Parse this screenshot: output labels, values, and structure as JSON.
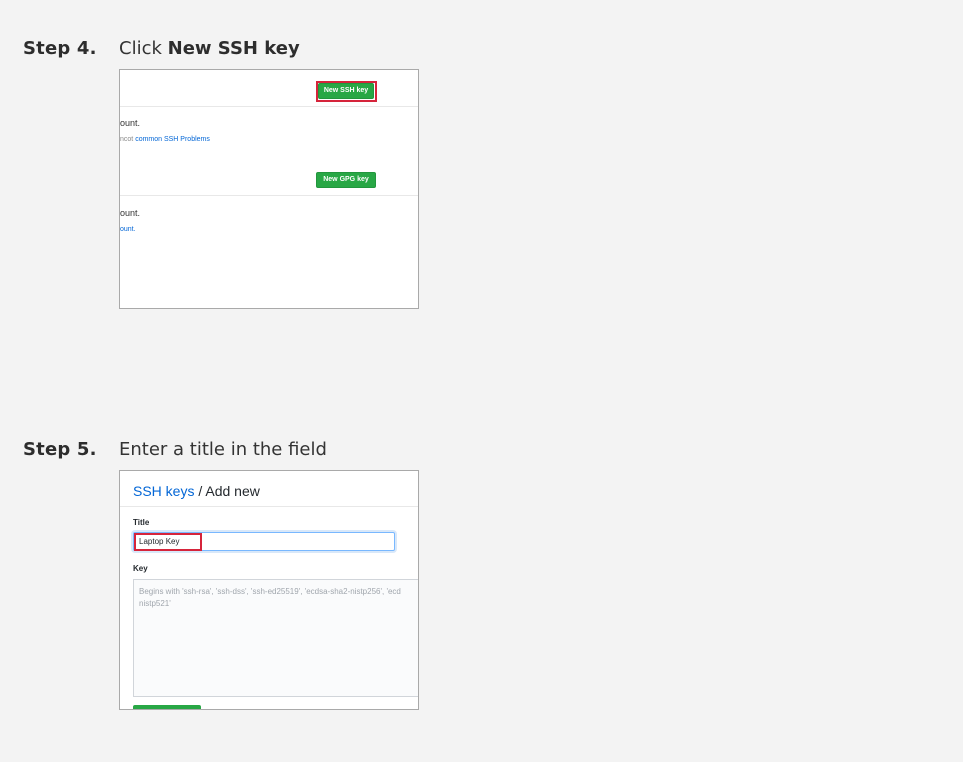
{
  "step4": {
    "label": "Step 4.",
    "text_prefix": "Click ",
    "text_bold": "New SSH key",
    "screenshot": {
      "new_ssh_button": "New SSH key",
      "ssh_text_1": "ount.",
      "ssh_text_2_prefix": "ncot ",
      "ssh_text_2_link": "common SSH Problems",
      "new_gpg_button": "New GPG key",
      "gpg_text_1": "ount.",
      "gpg_text_2_link": "ount."
    }
  },
  "step5": {
    "label": "Step 5.",
    "text": "Enter a title in the field",
    "screenshot": {
      "breadcrumb_link": "SSH keys",
      "breadcrumb_sep": " / ",
      "breadcrumb_current": "Add new",
      "title_label": "Title",
      "title_value": "Laptop Key",
      "key_label": "Key",
      "key_placeholder": "Begins with 'ssh-rsa', 'ssh-dss', 'ssh-ed25519', 'ecdsa-sha2-nistp256', 'ecd nistp521'"
    }
  },
  "colors": {
    "background": "#f3f3f3",
    "highlight": "#d6243b",
    "button_green": "#28a745",
    "link_blue": "#0366d6"
  }
}
